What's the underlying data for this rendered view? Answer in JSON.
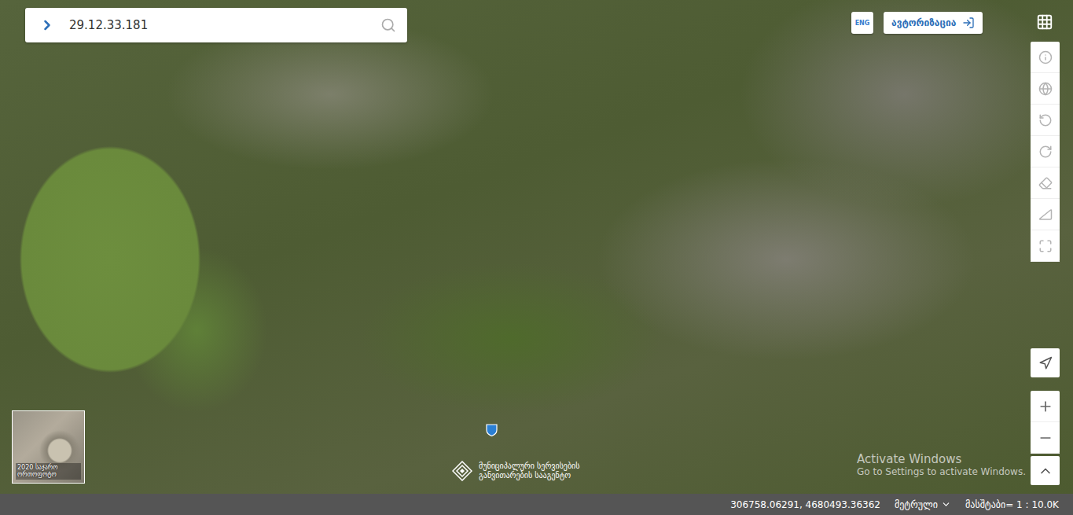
{
  "search": {
    "value": "29.12.33.181"
  },
  "header": {
    "language": "ENG",
    "login_button": "ავტორიზაცია"
  },
  "basemap_thumbnail": {
    "label": "2020 საჯარო ორთოფოტო"
  },
  "watermark": {
    "lines": [
      "მუნიციპალური სერვისების",
      "განვითარების სააგენტო"
    ]
  },
  "os_notice": {
    "title": "Activate Windows",
    "text": "Go to Settings to activate Windows."
  },
  "status_bar": {
    "coordinates": "306758.06291, 4680493.36362",
    "units": "მეტრული",
    "scale": "მასშტაბი= 1 : 10.0K"
  }
}
